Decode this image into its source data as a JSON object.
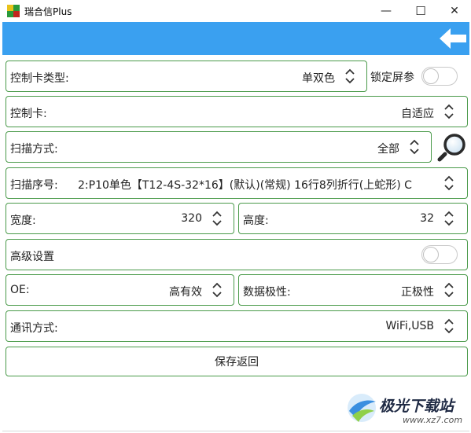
{
  "window": {
    "title": "瑞合信Plus",
    "minimize_glyph": "—",
    "maximize_glyph": "☐",
    "close_glyph": "✕"
  },
  "colors": {
    "header": "#3aa0f0",
    "border": "#4a9a4a"
  },
  "icons": {
    "back": "back-arrow-icon",
    "search": "magnifier-icon",
    "spinner": "up-down-chevron-icon"
  },
  "form": {
    "card_type": {
      "label": "控制卡类型:",
      "value": "单双色"
    },
    "lock_params": {
      "label": "锁定屏参",
      "on": false
    },
    "card": {
      "label": "控制卡:",
      "value": "自适应"
    },
    "scan_mode": {
      "label": "扫描方式:",
      "value": "全部"
    },
    "scan_seq": {
      "label": "扫描序号:",
      "value": "2:P10单色【T12-4S-32*16】(默认)(常规) 16行8列折行(上蛇形) C"
    },
    "width": {
      "label": "宽度:",
      "value": "320"
    },
    "height": {
      "label": "高度:",
      "value": "32"
    },
    "advanced": {
      "label": "高级设置",
      "on": false
    },
    "oe": {
      "label": "OE:",
      "value": "高有效"
    },
    "data_polarity": {
      "label": "数据极性:",
      "value": "正极性"
    },
    "comm_mode": {
      "label": "通讯方式:",
      "value": "WiFi,USB"
    },
    "save_label": "保存返回"
  },
  "watermark": {
    "name": "极光下载站",
    "url": "www.xz7.com"
  }
}
